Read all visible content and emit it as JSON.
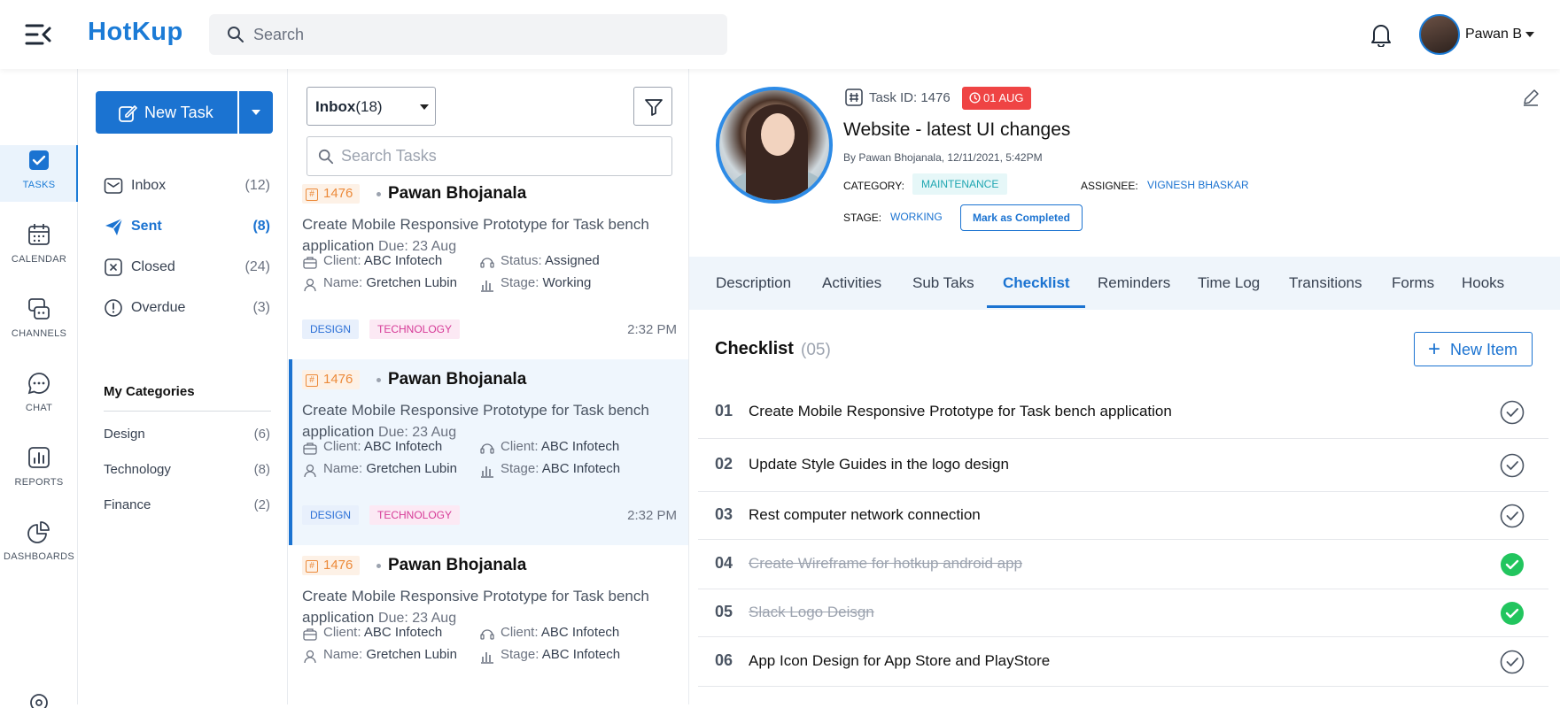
{
  "app": {
    "logo": "HotKup",
    "search_placeholder": "Search",
    "user_name": "Pawan B"
  },
  "rail": [
    {
      "label": "TASKS",
      "icon": "tasks-icon",
      "active": true
    },
    {
      "label": "CALENDAR",
      "icon": "calendar-icon"
    },
    {
      "label": "CHANNELS",
      "icon": "channels-icon"
    },
    {
      "label": "CHAT",
      "icon": "chat-icon"
    },
    {
      "label": "REPORTS",
      "icon": "reports-icon"
    },
    {
      "label": "DASHBOARDS",
      "icon": "dashboards-icon"
    }
  ],
  "left": {
    "new_task_label": "New Task",
    "folders": [
      {
        "label": "Inbox",
        "count": "(12)"
      },
      {
        "label": "Sent",
        "count": "(8)",
        "active": true
      },
      {
        "label": "Closed",
        "count": "(24)"
      },
      {
        "label": "Overdue",
        "count": "(3)"
      }
    ],
    "my_categories_title": "My Categories",
    "categories": [
      {
        "label": "Design",
        "count": "(6)"
      },
      {
        "label": "Technology",
        "count": "(8)"
      },
      {
        "label": "Finance",
        "count": "(2)"
      }
    ]
  },
  "list": {
    "inbox_label": "Inbox",
    "inbox_count": "(18)",
    "search_placeholder": "Search Tasks",
    "cards": [
      {
        "id": "1476",
        "name": "Pawan Bhojanala",
        "title": "Create Mobile Responsive Prototype for Task bench application",
        "due": "Due: 23 Aug",
        "m1k": "Client:",
        "m1v": "ABC Infotech",
        "m2k": "Status:",
        "m2v": "Assigned",
        "m3k": "Name:",
        "m3v": "Gretchen Lubin",
        "m4k": "Stage:",
        "m4v": "Working",
        "tag1": "DESIGN",
        "tag2": "TECHNOLOGY",
        "time": "2:32 PM"
      },
      {
        "id": "1476",
        "name": "Pawan Bhojanala",
        "title": "Create Mobile Responsive Prototype for Task bench application",
        "due": "Due: 23 Aug",
        "m1k": "Client:",
        "m1v": "ABC Infotech",
        "m2k": "Client:",
        "m2v": "ABC Infotech",
        "m3k": "Name:",
        "m3v": "Gretchen Lubin",
        "m4k": "Stage:",
        "m4v": "ABC Infotech",
        "tag1": "DESIGN",
        "tag2": "TECHNOLOGY",
        "time": "2:32 PM"
      },
      {
        "id": "1476",
        "name": "Pawan Bhojanala",
        "title": "Create Mobile Responsive Prototype for Task bench application",
        "due": "Due: 23 Aug",
        "m1k": "Client:",
        "m1v": "ABC Infotech",
        "m2k": "Client:",
        "m2v": "ABC Infotech",
        "m3k": "Name:",
        "m3v": "Gretchen Lubin",
        "m4k": "Stage:",
        "m4v": "ABC Infotech",
        "tag1": "",
        "tag2": "",
        "time": ""
      }
    ]
  },
  "detail": {
    "task_id": "Task ID: 1476",
    "date_badge": "01 AUG",
    "title": "Website - latest UI changes",
    "by": "By Pawan Bhojanala, 12/11/2021, 5:42PM",
    "category_label": "CATEGORY:",
    "category": "MAINTENANCE",
    "assignee_label": "ASSIGNEE:",
    "assignee": "VIGNESH BHASKAR",
    "stage_label": "STAGE:",
    "stage": "WORKING",
    "mark_completed": "Mark as Completed",
    "tabs": [
      "Description",
      "Activities",
      "Sub Taks",
      "Checklist",
      "Reminders",
      "Time Log",
      "Transitions",
      "Forms",
      "Hooks"
    ],
    "active_tab": "Checklist",
    "checklist_title": "Checklist",
    "checklist_count": "(05)",
    "new_item_label": "New Item",
    "items": [
      {
        "num": "01",
        "text": "Create Mobile Responsive Prototype for Task bench application",
        "done": false
      },
      {
        "num": "02",
        "text": "Update Style Guides in the logo design",
        "done": false
      },
      {
        "num": "03",
        "text": "Rest computer network connection",
        "done": false
      },
      {
        "num": "04",
        "text": "Create Wireframe for hotkup android app",
        "done": true
      },
      {
        "num": "05",
        "text": "Slack Logo Deisgn",
        "done": true
      },
      {
        "num": "06",
        "text": "App Icon Design for App Store and PlayStore",
        "done": false
      }
    ]
  },
  "colors": {
    "accent": "#1b73d1",
    "danger": "#ef4444",
    "success": "#22c55e",
    "orange": "#ec8a3a"
  }
}
